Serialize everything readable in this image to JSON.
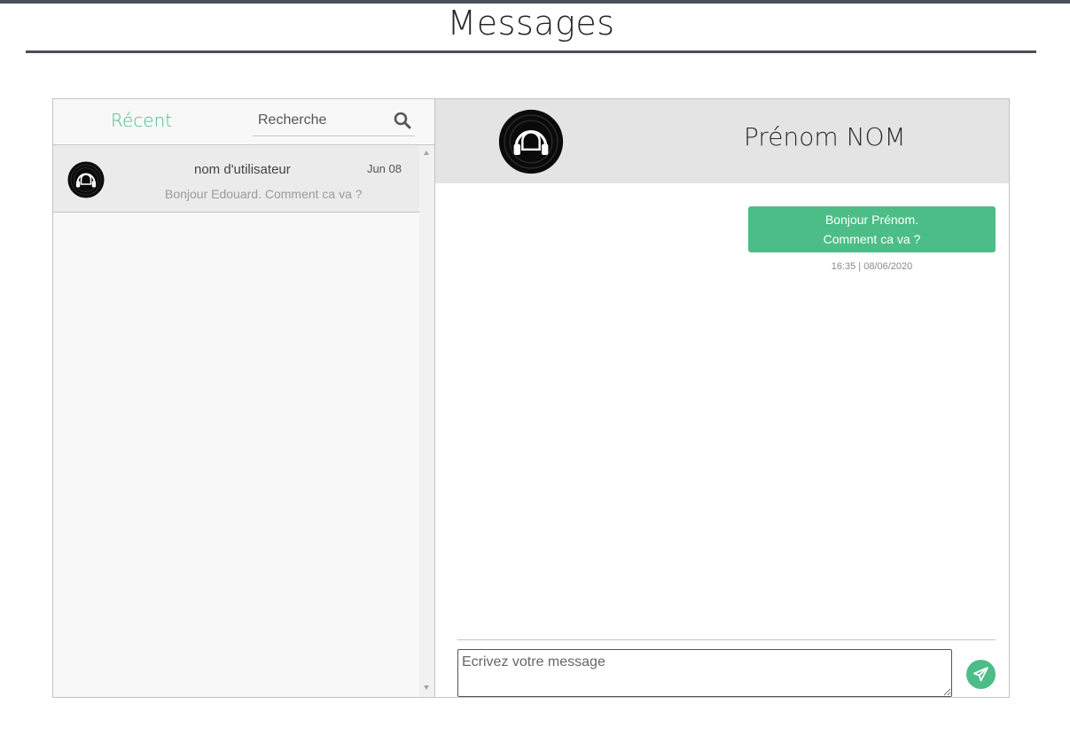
{
  "page": {
    "title": "Messages"
  },
  "inbox": {
    "recent_heading": "Récent",
    "search": {
      "placeholder": "Recherche",
      "icon": "search-icon"
    },
    "chats": [
      {
        "name": "nom d'utilisateur",
        "date": "Jun 08",
        "snippet": "Bonjour Edouard. Comment ca va ?",
        "avatar": "headphones-vinyl-avatar"
      }
    ]
  },
  "conversation": {
    "contact_name": "Prénom NOM",
    "avatar": "headphones-vinyl-avatar",
    "messages": [
      {
        "direction": "sent",
        "lines": [
          "Bonjour Prénom.",
          "Comment ca va ?"
        ],
        "time": "16:35 | 08/06/2020"
      }
    ]
  },
  "composer": {
    "placeholder": "Ecrivez votre message",
    "send_icon": "paper-plane-icon"
  },
  "colors": {
    "accent": "#4dbd87",
    "top_bar": "#4a4f59",
    "header_bg": "#e4e4e4",
    "selected_chat_bg": "#ebebeb"
  }
}
